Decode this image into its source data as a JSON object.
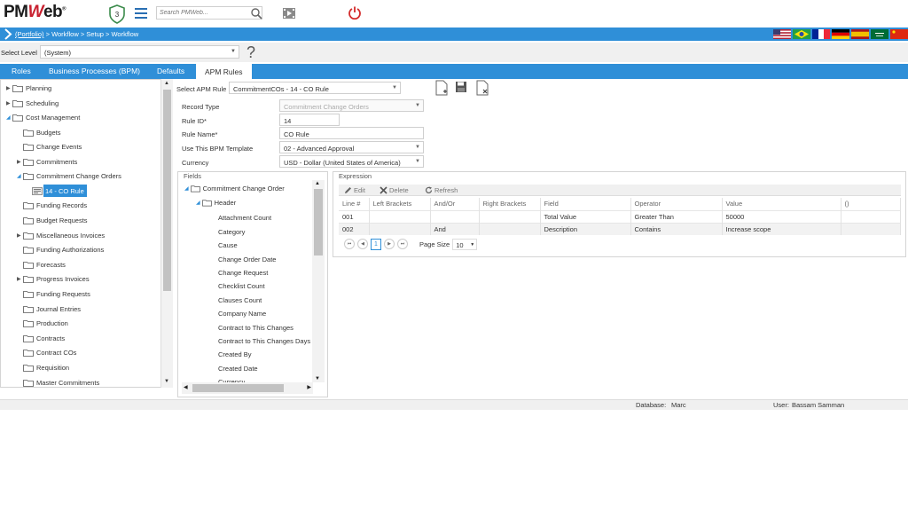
{
  "app": {
    "logo_pm": "PM",
    "logo_w": "W",
    "logo_eb": "eb",
    "logo_reg": "®",
    "shield_count": "3",
    "search_placeholder": "Search PMWeb..."
  },
  "breadcrumb": {
    "portfolio": "(Portfolio)",
    "rest": " > Workflow > Setup > Workflow"
  },
  "flags": [
    "us-flag",
    "brazil-flag",
    "france-flag",
    "germany-flag",
    "spain-flag",
    "saudi-flag",
    "china-flag"
  ],
  "level": {
    "label": "Select Level",
    "value": "(System)",
    "help": "?"
  },
  "tabs": [
    {
      "label": "Roles"
    },
    {
      "label": "Business Processes (BPM)"
    },
    {
      "label": "Defaults"
    },
    {
      "label": "APM Rules"
    }
  ],
  "tree": [
    {
      "label": "Planning",
      "arrow": "▶"
    },
    {
      "label": "Scheduling",
      "arrow": "▶"
    },
    {
      "label": "Cost Management",
      "arrow": "◢"
    },
    {
      "label": "Budgets",
      "arrow": ""
    },
    {
      "label": "Change Events",
      "arrow": ""
    },
    {
      "label": "Commitments",
      "arrow": "▶"
    },
    {
      "label": "Commitment Change Orders",
      "arrow": "◢"
    },
    {
      "label": "14 - CO Rule",
      "arrow": ""
    },
    {
      "label": "Funding Records",
      "arrow": ""
    },
    {
      "label": "Budget Requests",
      "arrow": ""
    },
    {
      "label": "Miscellaneous Invoices",
      "arrow": "▶"
    },
    {
      "label": "Funding Authorizations",
      "arrow": ""
    },
    {
      "label": "Forecasts",
      "arrow": ""
    },
    {
      "label": "Progress Invoices",
      "arrow": "▶"
    },
    {
      "label": "Funding Requests",
      "arrow": ""
    },
    {
      "label": "Journal Entries",
      "arrow": ""
    },
    {
      "label": "Production",
      "arrow": ""
    },
    {
      "label": "Contracts",
      "arrow": ""
    },
    {
      "label": "Contract COs",
      "arrow": ""
    },
    {
      "label": "Requisition",
      "arrow": ""
    },
    {
      "label": "Master Commitments",
      "arrow": ""
    }
  ],
  "rule": {
    "select_label": "Select APM Rule",
    "select_value": "CommitmentCOs - 14 - CO Rule",
    "record_type_label": "Record Type",
    "record_type_value": "Commitment Change Orders",
    "rule_id_label": "Rule ID*",
    "rule_id_value": "14",
    "rule_name_label": "Rule Name*",
    "rule_name_value": "CO Rule",
    "bpm_label": "Use This BPM Template",
    "bpm_value": "02 - Advanced Approval",
    "currency_label": "Currency",
    "currency_value": "USD - Dollar (United States of America)"
  },
  "fields": {
    "title": "Fields",
    "root": "Commitment Change Order",
    "header": "Header",
    "items": [
      "Attachment Count",
      "Category",
      "Cause",
      "Change Order Date",
      "Change Request",
      "Checklist Count",
      "Clauses Count",
      "Company Name",
      "Contract to This Changes",
      "Contract to This Changes Days",
      "Created By",
      "Created Date",
      "Currency"
    ]
  },
  "expression": {
    "title": "Expression",
    "toolbar": {
      "edit": "Edit",
      "delete": "Delete",
      "refresh": "Refresh"
    },
    "columns": [
      "Line #",
      "Left Brackets",
      "And/Or",
      "Right Brackets",
      "Field",
      "Operator",
      "Value",
      "()"
    ],
    "rows": [
      [
        "001",
        "",
        "",
        "",
        "Total Value",
        "Greater Than",
        "50000",
        ""
      ],
      [
        "002",
        "",
        "And",
        "",
        "Description",
        "Contains",
        "Increase scope",
        ""
      ]
    ],
    "pager": {
      "current": "1",
      "page_size_label": "Page Size",
      "page_size": "10"
    }
  },
  "footer": {
    "database_label": "Database:",
    "database_value": "Marc",
    "user_label": "User:",
    "user_value": "Bassam Samman"
  },
  "colors": {
    "accent": "#2f8fd8",
    "brand_red": "#c8202f"
  }
}
